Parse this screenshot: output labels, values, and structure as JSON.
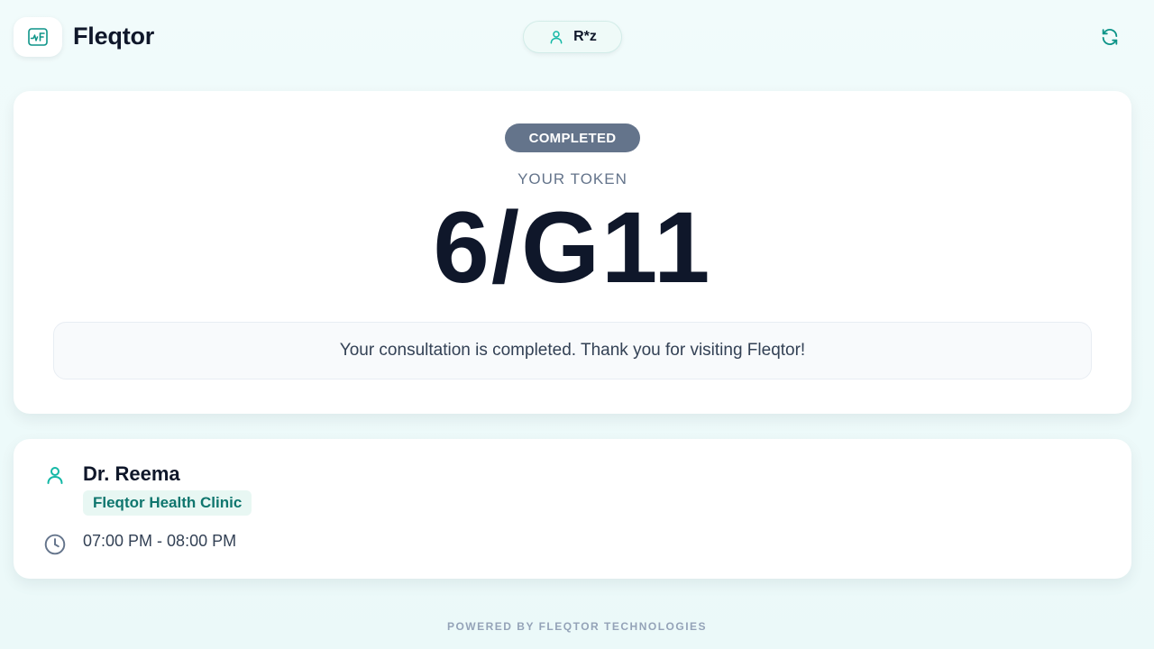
{
  "header": {
    "brand": "Fleqtor",
    "logo_icon": "pulse-f-icon",
    "user_label": "R*z",
    "user_icon": "user-icon",
    "refresh_icon": "refresh-icon"
  },
  "token_card": {
    "status": "COMPLETED",
    "label": "YOUR TOKEN",
    "token": "6/G11",
    "message": "Your consultation is completed. Thank you for visiting Fleqtor!"
  },
  "doctor": {
    "name": "Dr. Reema",
    "clinic": "Fleqtor Health Clinic",
    "time": "07:00 PM - 08:00 PM",
    "person_icon": "user-icon",
    "time_icon": "clock-icon"
  },
  "footer": {
    "text": "POWERED BY FLEQTOR TECHNOLOGIES"
  },
  "colors": {
    "accent": "#14b8a6",
    "status_badge": "#64748b",
    "text_dark": "#0f172a",
    "clinic_text": "#0f766e"
  }
}
